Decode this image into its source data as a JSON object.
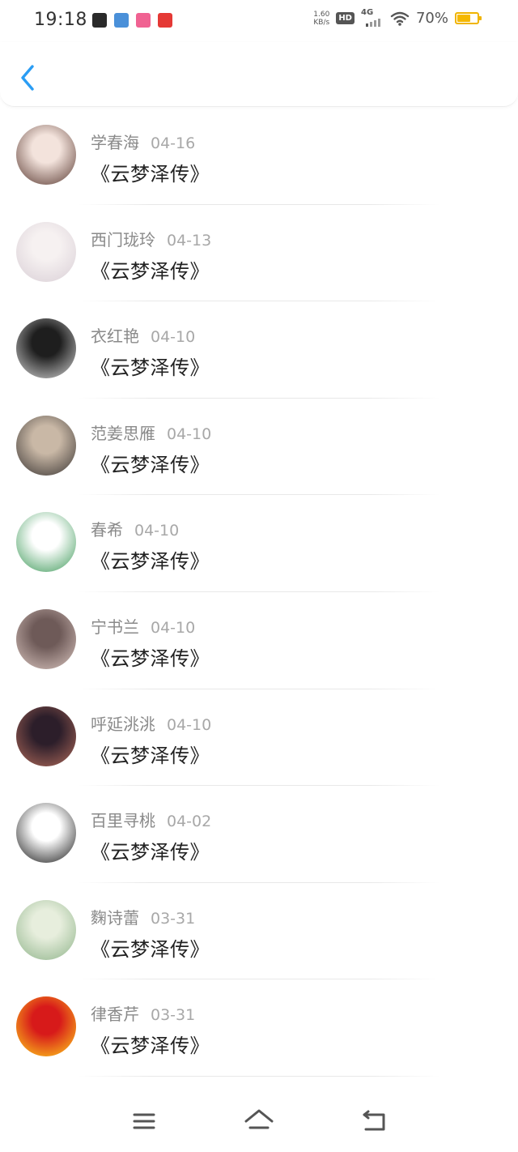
{
  "status_bar": {
    "time": "19:18",
    "net_speed_value": "1.60",
    "net_speed_unit": "KB/s",
    "hd_label": "HD",
    "network_label": "4G",
    "battery_percent": "70%",
    "battery_level": 0.7,
    "battery_color": "#f5b800",
    "notification_icons": [
      {
        "name": "app-notification-1-icon",
        "color": "#2a2a2a"
      },
      {
        "name": "app-notification-2-icon",
        "color": "#4a90d9"
      },
      {
        "name": "app-notification-3-icon",
        "color": "#f06292"
      },
      {
        "name": "app-notification-4-icon",
        "color": "#e53935"
      }
    ]
  },
  "header": {
    "back_icon": "chevron-left-icon",
    "accent_color": "#2a9df4"
  },
  "items": [
    {
      "name": "学春海",
      "date": "04-16",
      "content": "《云梦泽传》",
      "avatar_colors": [
        "#f3e3dc",
        "#5a3a32"
      ]
    },
    {
      "name": "西门珑玲",
      "date": "04-13",
      "content": "《云梦泽传》",
      "avatar_colors": [
        "#f6f1f1",
        "#d9cfd6"
      ]
    },
    {
      "name": "衣红艳",
      "date": "04-10",
      "content": "《云梦泽传》",
      "avatar_colors": [
        "#1e1e1e",
        "#d4d4d4"
      ]
    },
    {
      "name": "范姜思雁",
      "date": "04-10",
      "content": "《云梦泽传》",
      "avatar_colors": [
        "#c9b8a6",
        "#3a3533"
      ]
    },
    {
      "name": "春希",
      "date": "04-10",
      "content": "《云梦泽传》",
      "avatar_colors": [
        "#ffffff",
        "#3f9a5a"
      ]
    },
    {
      "name": "宁书兰",
      "date": "04-10",
      "content": "《云梦泽传》",
      "avatar_colors": [
        "#6e5a58",
        "#d8c4be"
      ]
    },
    {
      "name": "呼延洮洮",
      "date": "04-10",
      "content": "《云梦泽传》",
      "avatar_colors": [
        "#2c1e2a",
        "#b06a5a"
      ]
    },
    {
      "name": "百里寻桃",
      "date": "04-02",
      "content": "《云梦泽传》",
      "avatar_colors": [
        "#ffffff",
        "#1a1a1a"
      ]
    },
    {
      "name": "麴诗蕾",
      "date": "03-31",
      "content": "《云梦泽传》",
      "avatar_colors": [
        "#e7eedd",
        "#8fb48a"
      ]
    },
    {
      "name": "律香芹",
      "date": "03-31",
      "content": "《云梦泽传》",
      "avatar_colors": [
        "#d71a1a",
        "#ffd21a"
      ]
    }
  ],
  "nav_bar": {
    "menu_icon": "menu-icon",
    "home_icon": "home-icon",
    "back_icon": "back-icon"
  }
}
